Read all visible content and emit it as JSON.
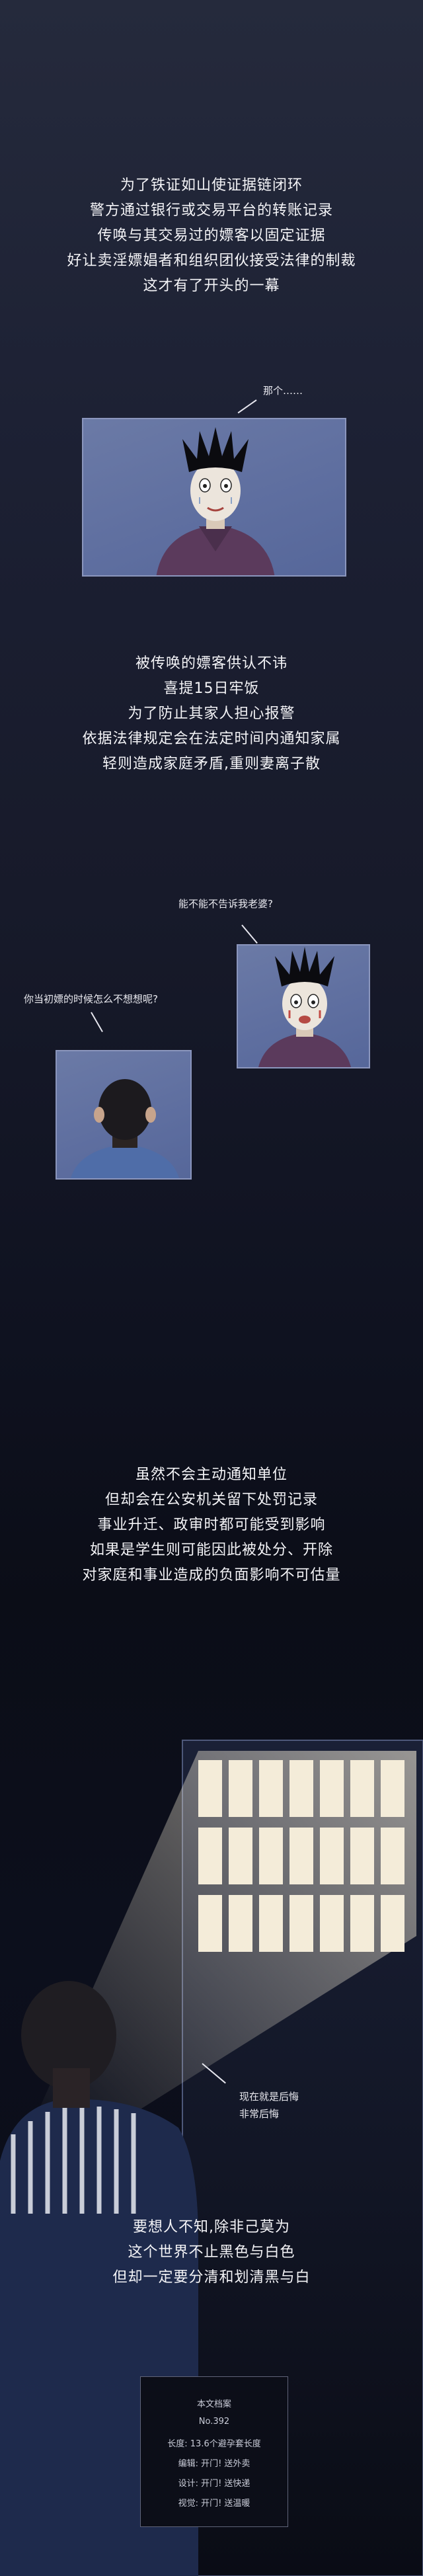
{
  "section1": {
    "lines": [
      "为了铁证如山使证据链闭环",
      "警方通过银行或交易平台的转账记录",
      "传唤与其交易过的嫖客以固定证据",
      "好让卖淫嫖娼者和组织团伙接受法律的制裁",
      "这才有了开头的一幕"
    ]
  },
  "panel1": {
    "speech": "那个……"
  },
  "section2": {
    "lines": [
      "被传唤的嫖客供认不讳",
      "喜提15日牢饭",
      "为了防止其家人担心报警",
      "依据法律规定会在法定时间内通知家属",
      "轻则造成家庭矛盾,重则妻离子散"
    ]
  },
  "panel2": {
    "speech": "能不能不告诉我老婆?"
  },
  "panel3": {
    "speech": "你当初嫖的时候怎么不想想呢?"
  },
  "section3": {
    "lines": [
      "虽然不会主动通知单位",
      "但却会在公安机关留下处罚记录",
      "事业升迁、政审时都可能受到影响",
      "如果是学生则可能因此被处分、开除",
      "对家庭和事业造成的负面影响不可估量"
    ]
  },
  "panel4": {
    "speech_1": "现在就是后悔",
    "speech_2": "非常后悔"
  },
  "section4": {
    "lines": [
      "要想人不知,除非己莫为",
      "这个世界不止黑色与白色",
      "但却一定要分清和划清黑与白"
    ]
  },
  "credits": {
    "title": "本文档案",
    "number": "No.392",
    "length": "长度: 13.6个避孕套长度",
    "editor": "编辑: 开门! 送外卖",
    "design": "设计: 开门! 送快递",
    "visual": "视觉: 开门! 送温暖"
  },
  "colors": {
    "accent_blue": "#5f6fa0",
    "shirt_purple": "#5b3a5c",
    "card_border": "#5f6378"
  }
}
